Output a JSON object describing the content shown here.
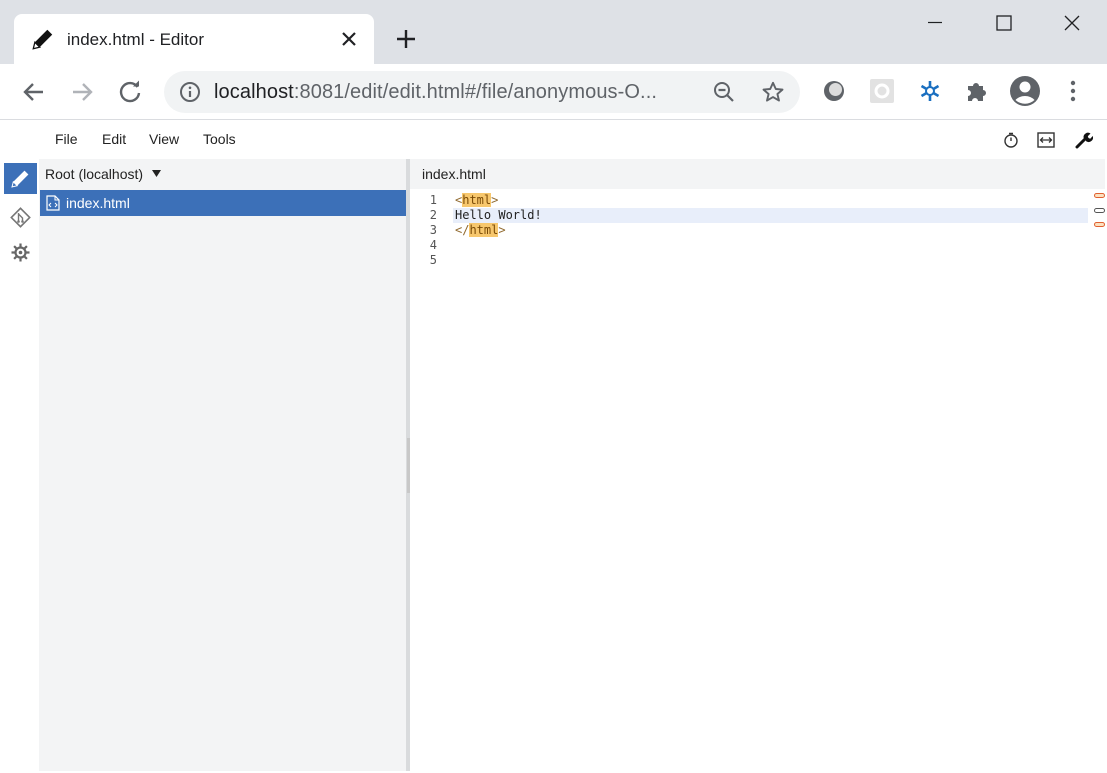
{
  "browser": {
    "tab_title": "index.html - Editor",
    "url_host": "localhost",
    "url_path": ":8081/edit/edit.html#/file/anonymous-O..."
  },
  "app": {
    "menu": [
      "File",
      "Edit",
      "View",
      "Tools"
    ],
    "sidebar": {
      "root_label": "Root (localhost)",
      "files": [
        "index.html"
      ]
    },
    "editor": {
      "tab_label": "index.html",
      "line_numbers": [
        "1",
        "2",
        "3",
        "4",
        "5"
      ],
      "lines": {
        "l1_open": "<",
        "l1_tag": "html",
        "l1_close": ">",
        "l2": "Hello World!",
        "l3_open": "</",
        "l3_tag": "html",
        "l3_close": ">"
      }
    }
  },
  "colors": {
    "accent": "#3c70b8",
    "sidebar_bg": "#f3f4f5",
    "tag_highlight": "#f7c76d",
    "chrome_bg": "#dee1e6"
  },
  "icons": {
    "tab": "pencil-icon",
    "activity": [
      "pencil-icon",
      "git-icon",
      "gear-icon"
    ],
    "tools": [
      "timer-icon",
      "width-icon",
      "wrench-icon"
    ]
  }
}
